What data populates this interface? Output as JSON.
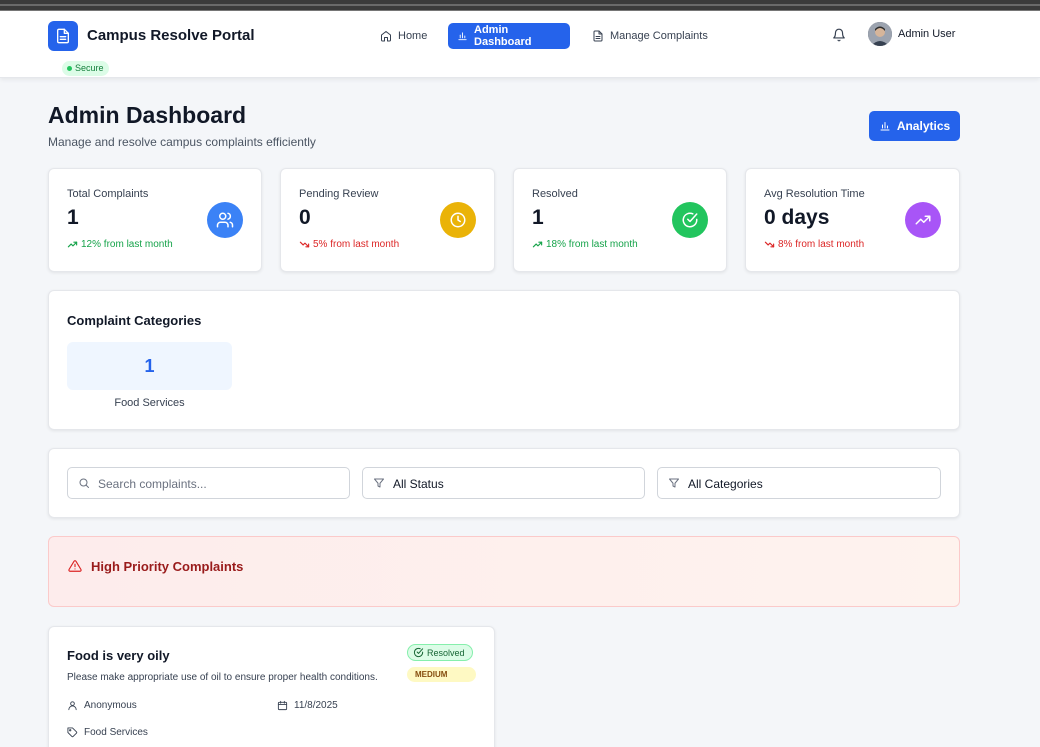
{
  "app": {
    "title": "Campus Resolve Portal",
    "secure_label": "Secure"
  },
  "nav": {
    "home": "Home",
    "admin_dashboard": "Admin Dashboard",
    "manage_complaints": "Manage Complaints",
    "active": "admin_dashboard"
  },
  "user": {
    "name": "Admin User"
  },
  "page": {
    "title": "Admin Dashboard",
    "subtitle": "Manage and resolve campus complaints efficiently",
    "analytics_label": "Analytics"
  },
  "stats": [
    {
      "label": "Total Complaints",
      "value": "1",
      "trend": "12% from last month",
      "trend_dir": "up",
      "icon": "users-icon",
      "color": "#3b82f6"
    },
    {
      "label": "Pending Review",
      "value": "0",
      "trend": "5% from last month",
      "trend_dir": "down",
      "icon": "clock-icon",
      "color": "#eab308"
    },
    {
      "label": "Resolved",
      "value": "1",
      "trend": "18% from last month",
      "trend_dir": "up",
      "icon": "check-circle-icon",
      "color": "#22c55e"
    },
    {
      "label": "Avg Resolution Time",
      "value": "0 days",
      "trend": "8% from last month",
      "trend_dir": "down",
      "icon": "trending-up-icon",
      "color": "#a855f7"
    }
  ],
  "categories": {
    "title": "Complaint Categories",
    "items": [
      {
        "count": "1",
        "name": "Food Services"
      }
    ]
  },
  "filters": {
    "search_placeholder": "Search complaints...",
    "status_value": "All Status",
    "category_value": "All Categories"
  },
  "priority": {
    "title": "High Priority Complaints"
  },
  "complaint": {
    "title": "Food is very oily",
    "description": "Please make appropriate use of oil to ensure proper health conditions.",
    "status": "Resolved",
    "priority": "MEDIUM",
    "author": "Anonymous",
    "date": "11/8/2025",
    "category": "Food Services"
  },
  "colors": {
    "primary": "#2563eb",
    "success": "#16a34a",
    "danger": "#dc2626"
  }
}
